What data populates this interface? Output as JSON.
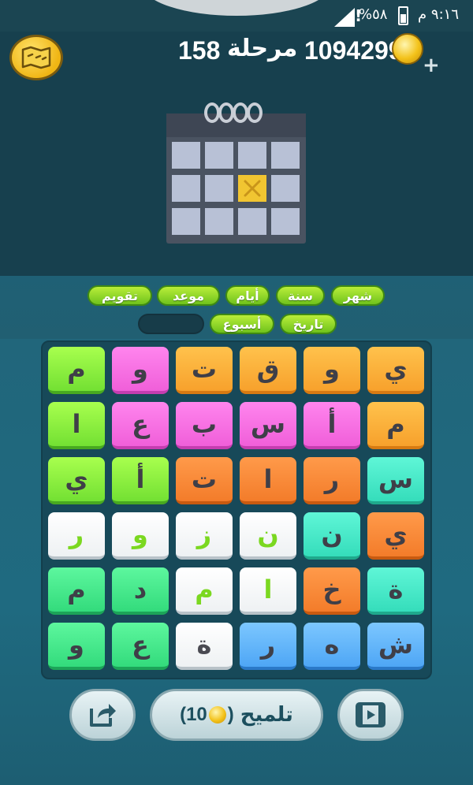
{
  "status_bar": {
    "time": "٩:١٦ م",
    "battery": "%٥٨",
    "alert": "!"
  },
  "header": {
    "coins": "1094299",
    "level_label": "مرحلة",
    "level_number": "158"
  },
  "picture": {
    "subject": "calendar-icon"
  },
  "answers": {
    "row1": [
      "شهر",
      "سنة",
      "أيام",
      "موعد",
      "تقويم"
    ],
    "row2": [
      "تاريخ",
      "أسبوع",
      ""
    ]
  },
  "board": {
    "rows": [
      [
        "ي",
        "و",
        "ق",
        "ت",
        "و",
        "م"
      ],
      [
        "م",
        "أ",
        "س",
        "ب",
        "ع",
        "ا"
      ],
      [
        "س",
        "ر",
        "ا",
        "ت",
        "أ",
        "ي"
      ],
      [
        "ي",
        "ن",
        "ن",
        "ز",
        "و",
        "ر"
      ],
      [
        "ة",
        "خ",
        "ا",
        "م",
        "د",
        "م"
      ],
      [
        "ش",
        "ه",
        "ر",
        "ة",
        "ع",
        "و"
      ]
    ]
  },
  "buttons": {
    "hint_label": "تلميح",
    "hint_cost_open": "(",
    "hint_cost": "10",
    "hint_cost_close": ")",
    "share_icon": "share-icon",
    "video_icon": "video-icon"
  }
}
